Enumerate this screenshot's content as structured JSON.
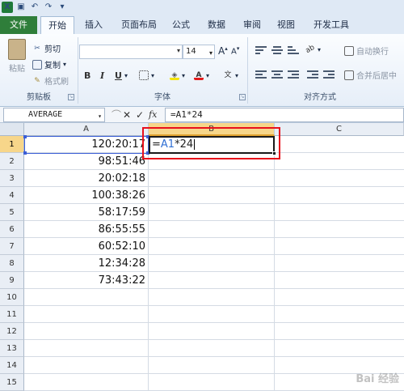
{
  "qat": {
    "logo": "X",
    "save_icon": "save-icon",
    "undo_icon": "undo-icon",
    "redo_icon": "redo-icon"
  },
  "tabs": [
    {
      "label": "文件"
    },
    {
      "label": "开始"
    },
    {
      "label": "插入"
    },
    {
      "label": "页面布局"
    },
    {
      "label": "公式"
    },
    {
      "label": "数据"
    },
    {
      "label": "审阅"
    },
    {
      "label": "视图"
    },
    {
      "label": "开发工具"
    }
  ],
  "ribbon": {
    "clipboard": {
      "paste": "粘贴",
      "cut": "剪切",
      "copy": "复制",
      "format_painter": "格式刷",
      "group": "剪贴板"
    },
    "font": {
      "size": "14",
      "bold": "B",
      "italic": "I",
      "underline": "U",
      "phonetic": "wén",
      "group": "字体"
    },
    "alignment": {
      "wrap": "自动换行",
      "merge": "合并后居中",
      "group": "对齐方式"
    }
  },
  "formula_bar": {
    "name_box": "AVERAGE",
    "cancel": "✕",
    "enter": "✓",
    "fx": "fx",
    "formula": "=A1*24"
  },
  "grid": {
    "columns": [
      "A",
      "B",
      "C"
    ],
    "rows": [
      "1",
      "2",
      "3",
      "4",
      "5",
      "6",
      "7",
      "8",
      "9",
      "10",
      "11",
      "12",
      "13",
      "14",
      "15"
    ],
    "colA": [
      "120:20:17",
      "98:51:46",
      "20:02:18",
      "100:38:26",
      "58:17:59",
      "86:55:55",
      "60:52:10",
      "12:34:28",
      "73:43:22"
    ],
    "editing": {
      "prefix": "=",
      "ref": "A1",
      "suffix": "*24"
    }
  },
  "watermark": "Bai 经验"
}
